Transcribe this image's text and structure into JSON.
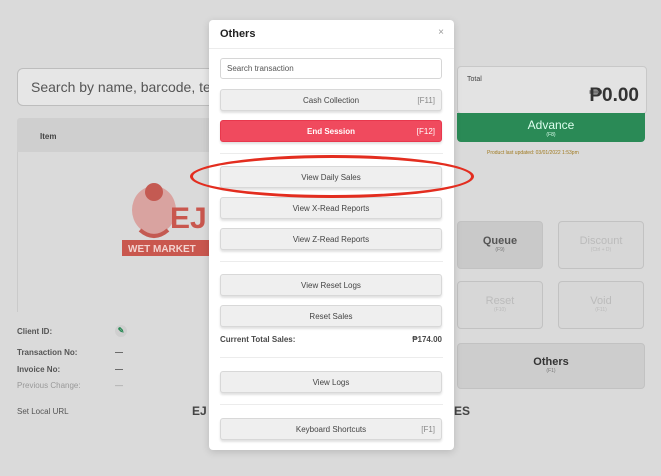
{
  "background": {
    "search_placeholder": "Search by name, barcode, te",
    "item_header": "Item",
    "logo_text": "EJ",
    "logo_subtext": "WET MARKET",
    "total_label": "Total",
    "total_amount": "₱0.00",
    "advance_label": "Advance",
    "advance_key": "(F8)",
    "last_updated": "Product last updated: 03/01/2022 1:53pm",
    "queue_label": "Queue",
    "queue_key": "(F9)",
    "discount_label": "Discount",
    "discount_key": "(Ctrl + D)",
    "reset_label": "Reset",
    "reset_key": "(F10)",
    "void_label": "Void",
    "void_key": "(F11)",
    "others_label": "Others",
    "others_key": "(F1)",
    "client_id_label": "Client ID:",
    "transaction_no_label": "Transaction No:",
    "transaction_no_value": "—",
    "invoice_no_label": "Invoice No:",
    "invoice_no_value": "—",
    "previous_change_label": "Previous Change:",
    "previous_change_value": "—",
    "set_local_url": "Set Local URL",
    "footer_left": "EJ",
    "footer_right": "ES"
  },
  "modal": {
    "title": "Others",
    "close": "×",
    "search_placeholder": "Search transaction",
    "buttons": {
      "cash_collection": {
        "label": "Cash Collection",
        "key": "[F11]"
      },
      "end_session": {
        "label": "End Session",
        "key": "[F12]"
      },
      "view_daily_sales": {
        "label": "View Daily Sales"
      },
      "view_x_read": {
        "label": "View X-Read Reports"
      },
      "view_z_read": {
        "label": "View Z-Read Reports"
      },
      "view_reset_logs": {
        "label": "View Reset Logs"
      },
      "reset_sales": {
        "label": "Reset Sales"
      },
      "view_logs": {
        "label": "View Logs"
      },
      "keyboard_shortcuts": {
        "label": "Keyboard Shortcuts",
        "key": "[F1]"
      }
    },
    "current_total_sales_label": "Current Total Sales:",
    "current_total_sales_value": "₱174.00"
  },
  "colors": {
    "end_session": "#f04a5e",
    "advance": "#2a8a56",
    "highlight_oval": "#e32d1f"
  }
}
